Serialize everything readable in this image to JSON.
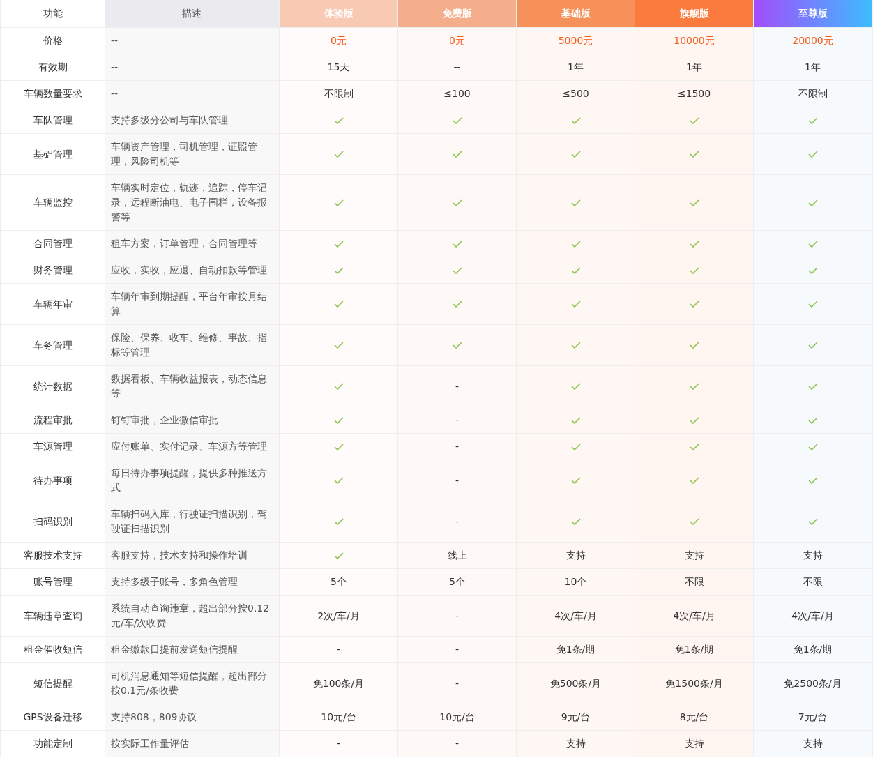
{
  "header": {
    "feature": "功能",
    "description": "描述"
  },
  "plans": [
    {
      "label": "体验版",
      "kind": "solid",
      "color": "#f8cab4"
    },
    {
      "label": "免费版",
      "kind": "solid",
      "color": "#f4ae8c"
    },
    {
      "label": "基础版",
      "kind": "solid",
      "color": "#f6915a"
    },
    {
      "label": "旗舰版",
      "kind": "solid",
      "color": "#fb7a3d"
    },
    {
      "label": "至尊版",
      "kind": "gradient",
      "color": "#a24dfc"
    }
  ],
  "rows": [
    {
      "feature": "价格",
      "description": "--",
      "values": [
        {
          "kind": "price",
          "text": "0元"
        },
        {
          "kind": "price",
          "text": "0元"
        },
        {
          "kind": "price",
          "text": "5000元"
        },
        {
          "kind": "price",
          "text": "10000元"
        },
        {
          "kind": "price",
          "text": "20000元"
        }
      ]
    },
    {
      "feature": "有效期",
      "description": "--",
      "values": [
        {
          "kind": "text",
          "text": "15天"
        },
        {
          "kind": "text",
          "text": "--"
        },
        {
          "kind": "text",
          "text": "1年"
        },
        {
          "kind": "text",
          "text": "1年"
        },
        {
          "kind": "text",
          "text": "1年"
        }
      ]
    },
    {
      "feature": "车辆数量要求",
      "description": "--",
      "values": [
        {
          "kind": "text",
          "text": "不限制"
        },
        {
          "kind": "text",
          "text": "≤100"
        },
        {
          "kind": "text",
          "text": "≤500"
        },
        {
          "kind": "text",
          "text": "≤1500"
        },
        {
          "kind": "text",
          "text": "不限制"
        }
      ]
    },
    {
      "feature": "车队管理",
      "description": "支持多级分公司与车队管理",
      "values": [
        {
          "kind": "check"
        },
        {
          "kind": "check"
        },
        {
          "kind": "check"
        },
        {
          "kind": "check"
        },
        {
          "kind": "check"
        }
      ]
    },
    {
      "feature": "基础管理",
      "description": "车辆资产管理，司机管理，证照管理，风险司机等",
      "values": [
        {
          "kind": "check"
        },
        {
          "kind": "check"
        },
        {
          "kind": "check"
        },
        {
          "kind": "check"
        },
        {
          "kind": "check"
        }
      ]
    },
    {
      "feature": "车辆监控",
      "description": "车辆实时定位，轨迹，追踪，停车记录，远程断油电、电子围栏，设备报警等",
      "values": [
        {
          "kind": "check"
        },
        {
          "kind": "check"
        },
        {
          "kind": "check"
        },
        {
          "kind": "check"
        },
        {
          "kind": "check"
        }
      ]
    },
    {
      "feature": "合同管理",
      "description": "租车方案，订单管理，合同管理等",
      "values": [
        {
          "kind": "check"
        },
        {
          "kind": "check"
        },
        {
          "kind": "check"
        },
        {
          "kind": "check"
        },
        {
          "kind": "check"
        }
      ]
    },
    {
      "feature": "财务管理",
      "description": "应收，实收，应退、自动扣款等管理",
      "values": [
        {
          "kind": "check"
        },
        {
          "kind": "check"
        },
        {
          "kind": "check"
        },
        {
          "kind": "check"
        },
        {
          "kind": "check"
        }
      ]
    },
    {
      "feature": "车辆年审",
      "description": "车辆年审到期提醒，平台年审按月结算",
      "values": [
        {
          "kind": "check"
        },
        {
          "kind": "check"
        },
        {
          "kind": "check"
        },
        {
          "kind": "check"
        },
        {
          "kind": "check"
        }
      ]
    },
    {
      "feature": "车务管理",
      "description": "保险、保养、收车、维修、事故、指标等管理",
      "values": [
        {
          "kind": "check"
        },
        {
          "kind": "check"
        },
        {
          "kind": "check"
        },
        {
          "kind": "check"
        },
        {
          "kind": "check"
        }
      ]
    },
    {
      "feature": "统计数据",
      "description": "数据看板、车辆收益报表，动态信息等",
      "values": [
        {
          "kind": "check"
        },
        {
          "kind": "text",
          "text": "-"
        },
        {
          "kind": "check"
        },
        {
          "kind": "check"
        },
        {
          "kind": "check"
        }
      ]
    },
    {
      "feature": "流程审批",
      "description": "钉钉审批，企业微信审批",
      "values": [
        {
          "kind": "check"
        },
        {
          "kind": "text",
          "text": "-"
        },
        {
          "kind": "check"
        },
        {
          "kind": "check"
        },
        {
          "kind": "check"
        }
      ]
    },
    {
      "feature": "车源管理",
      "description": "应付账单、实付记录、车源方等管理",
      "values": [
        {
          "kind": "check"
        },
        {
          "kind": "text",
          "text": "-"
        },
        {
          "kind": "check"
        },
        {
          "kind": "check"
        },
        {
          "kind": "check"
        }
      ]
    },
    {
      "feature": "待办事项",
      "description": "每日待办事项提醒，提供多种推送方式",
      "values": [
        {
          "kind": "check"
        },
        {
          "kind": "text",
          "text": "-"
        },
        {
          "kind": "check"
        },
        {
          "kind": "check"
        },
        {
          "kind": "check"
        }
      ]
    },
    {
      "feature": "扫码识别",
      "description": "车辆扫码入库，行驶证扫描识别，驾驶证扫描识别",
      "values": [
        {
          "kind": "check"
        },
        {
          "kind": "text",
          "text": "-"
        },
        {
          "kind": "check"
        },
        {
          "kind": "check"
        },
        {
          "kind": "check"
        }
      ]
    },
    {
      "feature": "客服技术支持",
      "description": "客服支持，技术支持和操作培训",
      "values": [
        {
          "kind": "check"
        },
        {
          "kind": "text",
          "text": "线上"
        },
        {
          "kind": "text",
          "text": "支持"
        },
        {
          "kind": "text",
          "text": "支持"
        },
        {
          "kind": "text",
          "text": "支持"
        }
      ]
    },
    {
      "feature": "账号管理",
      "description": "支持多级子账号，多角色管理",
      "values": [
        {
          "kind": "text",
          "text": "5个"
        },
        {
          "kind": "text",
          "text": "5个"
        },
        {
          "kind": "text",
          "text": "10个"
        },
        {
          "kind": "text",
          "text": "不限"
        },
        {
          "kind": "text",
          "text": "不限"
        }
      ]
    },
    {
      "feature": "车辆违章查询",
      "description": "系统自动查询违章，超出部分按0.12元/车/次收费",
      "values": [
        {
          "kind": "text",
          "text": "2次/车/月"
        },
        {
          "kind": "text",
          "text": "-"
        },
        {
          "kind": "text",
          "text": "4次/车/月"
        },
        {
          "kind": "text",
          "text": "4次/车/月"
        },
        {
          "kind": "text",
          "text": "4次/车/月"
        }
      ]
    },
    {
      "feature": "租金催收短信",
      "description": "租金缴款日提前发送短信提醒",
      "values": [
        {
          "kind": "text",
          "text": "-"
        },
        {
          "kind": "text",
          "text": "-"
        },
        {
          "kind": "text",
          "text": "免1条/期"
        },
        {
          "kind": "text",
          "text": "免1条/期"
        },
        {
          "kind": "text",
          "text": "免1条/期"
        }
      ]
    },
    {
      "feature": "短信提醒",
      "description": "司机消息通知等短信提醒，超出部分按0.1元/条收费",
      "values": [
        {
          "kind": "text",
          "text": "免100条/月"
        },
        {
          "kind": "text",
          "text": "-"
        },
        {
          "kind": "text",
          "text": "免500条/月"
        },
        {
          "kind": "text",
          "text": "免1500条/月"
        },
        {
          "kind": "text",
          "text": "免2500条/月"
        }
      ]
    },
    {
      "feature": "GPS设备迁移",
      "description": "支持808，809协议",
      "values": [
        {
          "kind": "text",
          "text": "10元/台"
        },
        {
          "kind": "text",
          "text": "10元/台"
        },
        {
          "kind": "text",
          "text": "9元/台"
        },
        {
          "kind": "text",
          "text": "8元/台"
        },
        {
          "kind": "text",
          "text": "7元/台"
        }
      ]
    },
    {
      "feature": "功能定制",
      "description": "按实际工作量评估",
      "values": [
        {
          "kind": "text",
          "text": "-"
        },
        {
          "kind": "text",
          "text": "-"
        },
        {
          "kind": "text",
          "text": "支持"
        },
        {
          "kind": "text",
          "text": "支持"
        },
        {
          "kind": "text",
          "text": "支持"
        }
      ]
    }
  ]
}
